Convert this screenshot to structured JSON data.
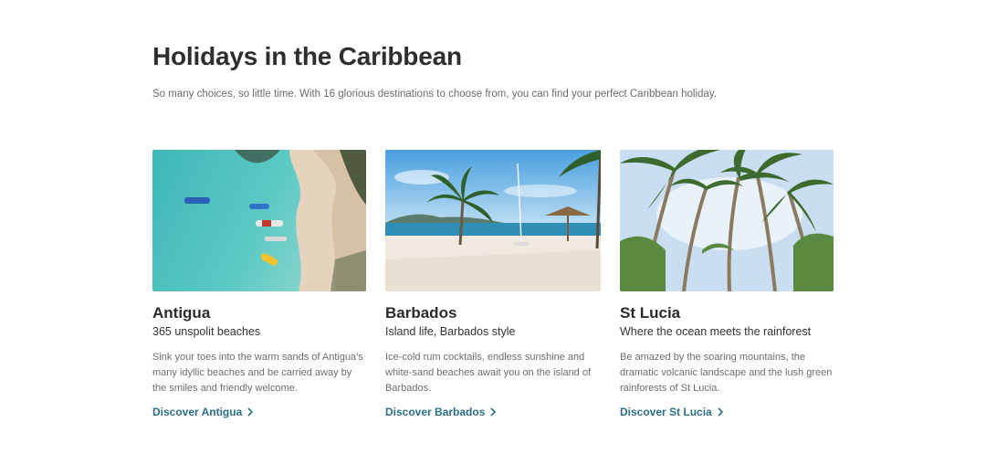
{
  "header": {
    "title": "Holidays in the Caribbean",
    "subtitle": "So many choices, so little time. With 16 glorious destinations to choose from, you can find your perfect Caribbean holiday."
  },
  "cards": [
    {
      "name": "Antigua",
      "tagline": "365 unspolit beaches",
      "description": "Sink your toes into the warm sands of Antigua's many idyllic beaches and be carried away by the smiles and friendly welcome.",
      "link": "Discover Antigua"
    },
    {
      "name": "Barbados",
      "tagline": "Island life, Barbados style",
      "description": "Ice-cold rum cocktails, endless sunshine and white-sand beaches await you on the island of Barbados.",
      "link": "Discover Barbados"
    },
    {
      "name": "St Lucia",
      "tagline": "Where the ocean meets the rainforest",
      "description": "Be amazed by the soaring mountains, the dramatic volcanic landscape and the lush green rainforests of St Lucia.",
      "link": "Discover St Lucia"
    }
  ],
  "colors": {
    "link": "#2a6f86",
    "heading": "#2f2f2f",
    "body_text": "#6d6d6d"
  },
  "icons": {
    "link_arrow": "chevron-right-icon"
  }
}
